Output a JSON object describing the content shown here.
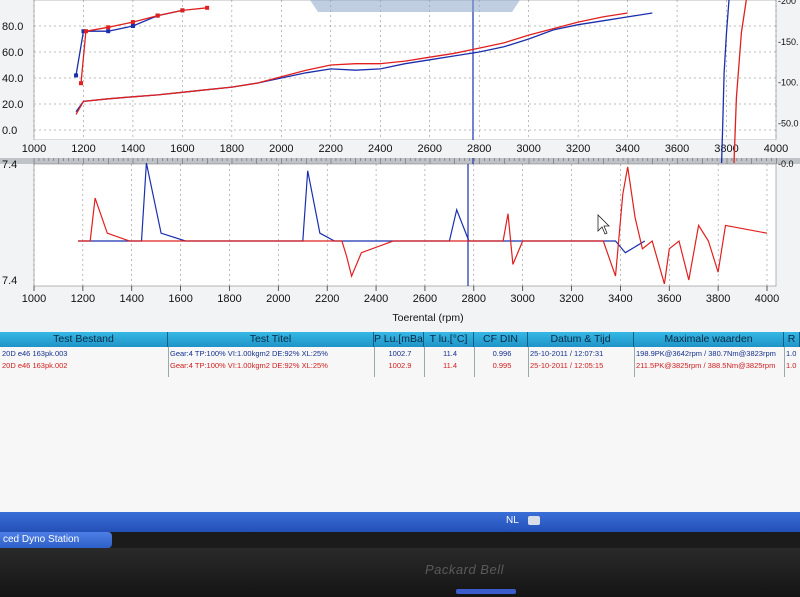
{
  "top_chart": {
    "y_left_ticks": [
      "80.0",
      "60.0",
      "40.0",
      "20.0",
      "0.0"
    ],
    "y_right_ticks": [
      "-200",
      "-150.",
      "-100.",
      "-50.0",
      "-0.0"
    ],
    "x_ticks": [
      "1000",
      "1200",
      "1400",
      "1600",
      "1800",
      "2000",
      "2200",
      "2400",
      "2600",
      "2800",
      "3000",
      "3200",
      "3400",
      "3600",
      "3800",
      "4000"
    ]
  },
  "bottom_chart": {
    "y_ticks": [
      "7.4",
      "7.4"
    ],
    "x_ticks": [
      "1000",
      "1200",
      "1400",
      "1600",
      "1800",
      "2000",
      "2200",
      "2400",
      "2600",
      "2800",
      "3000",
      "3200",
      "3400",
      "3600",
      "3800",
      "4000"
    ],
    "x_label": "Toerental (rpm)"
  },
  "chart_data": [
    {
      "type": "line",
      "x_range": [
        1000,
        4000
      ],
      "ylim": [
        0,
        80
      ],
      "y2lim": [
        0,
        200
      ],
      "x_tick_labels": [
        "1000",
        "1200",
        "1400",
        "1600",
        "1800",
        "2000",
        "2200",
        "2400",
        "2600",
        "2800",
        "3000",
        "3200",
        "3400",
        "3600",
        "3800",
        "4000"
      ],
      "y_tick_labels": [
        "80.0",
        "60.0",
        "40.0",
        "20.0",
        "0.0"
      ],
      "y2_tick_labels": [
        "-200",
        "-150.",
        "-100.",
        "-50.0",
        "-0.0"
      ],
      "colors": {
        "blue": "#1a2fae",
        "red": "#e0201e"
      },
      "series": [
        {
          "color": "blue",
          "x": [
            1170,
            1200,
            1300,
            1400,
            1500,
            1600,
            1700,
            1800,
            1900,
            2000,
            2100,
            2200,
            2300,
            2400,
            2500,
            2600,
            2700,
            2800,
            2900,
            3000,
            3100,
            3200,
            3300,
            3400,
            3500
          ],
          "y": [
            14,
            22,
            24,
            25.5,
            27,
            29,
            31,
            33,
            36,
            40,
            44,
            47,
            46,
            47,
            51,
            54,
            57,
            60,
            64,
            70,
            77,
            81,
            84,
            87,
            90
          ]
        },
        {
          "color": "red",
          "x": [
            1170,
            1200,
            1300,
            1400,
            1500,
            1600,
            1700,
            1800,
            1900,
            2000,
            2100,
            2200,
            2300,
            2400,
            2500,
            2600,
            2700,
            2800,
            2900,
            3000,
            3100,
            3200,
            3300,
            3400
          ],
          "y": [
            12,
            22,
            24,
            25.5,
            27,
            29,
            31,
            33,
            36,
            41,
            46,
            50,
            51,
            51,
            53,
            56,
            59,
            63,
            67,
            73,
            78,
            83,
            87,
            90
          ]
        },
        {
          "color": "blue",
          "x": [
            1170,
            1200,
            1300,
            1400,
            1500,
            1600
          ],
          "y": [
            42,
            76,
            76,
            80,
            88,
            92
          ]
        },
        {
          "color": "red",
          "x": [
            1190,
            1210,
            1300,
            1400,
            1500,
            1600,
            1700
          ],
          "y": [
            36,
            76,
            79,
            83,
            88,
            92,
            94
          ]
        },
        {
          "color": "blue",
          "x": [
            3780,
            3785,
            3790,
            3800,
            3810
          ],
          "y": [
            0,
            50,
            110,
            160,
            200
          ]
        },
        {
          "color": "red",
          "x": [
            3830,
            3835,
            3840,
            3850,
            3860,
            3880
          ],
          "y": [
            0,
            40,
            80,
            120,
            160,
            200
          ]
        }
      ]
    },
    {
      "type": "line",
      "x_range": [
        1000,
        4000
      ],
      "xlabel": "Toerental (rpm)",
      "x_tick_labels": [
        "1000",
        "1200",
        "1400",
        "1600",
        "1800",
        "2000",
        "2200",
        "2400",
        "2600",
        "2800",
        "3000",
        "3200",
        "3400",
        "3600",
        "3800",
        "4000"
      ],
      "y_tick_labels": [
        "7.4",
        "7.4"
      ],
      "colors": {
        "blue": "#1a2fae",
        "red": "#e0201e"
      },
      "series": [
        {
          "color": "blue",
          "x": [
            1180,
            1400,
            1440,
            1460,
            1520,
            1620,
            2060,
            2100,
            2120,
            2170,
            2230,
            2670,
            2700,
            2730,
            2780,
            3380,
            3420,
            3500
          ],
          "y": [
            0,
            0,
            0,
            1.0,
            0.1,
            0,
            0,
            0,
            0.9,
            0.1,
            0,
            0,
            0,
            0.4,
            0,
            0,
            -0.15,
            0
          ]
        },
        {
          "color": "red",
          "x": [
            1180,
            1230,
            1250,
            1300,
            1390,
            2260,
            2280,
            2300,
            2340,
            2470,
            2920,
            2940,
            2960,
            3000,
            3330,
            3380,
            3410,
            3430,
            3460,
            3490,
            3530,
            3580,
            3600,
            3640,
            3680,
            3720,
            3760,
            3800,
            3830,
            4000
          ],
          "y": [
            0,
            0,
            0.55,
            0.1,
            0,
            0,
            -0.2,
            -0.45,
            -0.15,
            0,
            0,
            0.35,
            -0.3,
            0,
            0,
            -0.45,
            0.6,
            0.95,
            0.3,
            -0.1,
            0,
            -0.55,
            -0.1,
            0,
            -0.5,
            0.2,
            0,
            -0.4,
            0.2,
            0.1
          ]
        }
      ]
    }
  ],
  "table": {
    "headers": [
      "Test Bestand",
      "Test Titel",
      "P Lu.[mBar]",
      "T lu.[°C]",
      "CF DIN",
      "Datum & Tijd",
      "Maximale waarden",
      "R"
    ],
    "rows": [
      {
        "file": "20D e46 163pk.003",
        "title": "Gear:4 TP:100% VI:1.00kgm2 DE:92% XL:25%",
        "p": "1002.7",
        "t": "11.4",
        "cf": "0.996",
        "date": "25-10-2011 / 12:07:31",
        "max": "198.9PK@3642rpm / 380.7Nm@3823rpm",
        "r": "1.0",
        "color": "#12308e"
      },
      {
        "file": "20D e46 163pk.002",
        "title": "Gear:4 TP:100% VI:1.00kgm2 DE:92% XL:25%",
        "p": "1002.9",
        "t": "11.4",
        "cf": "0.995",
        "date": "25-10-2011 / 12:05:15",
        "max": "211.5PK@3825rpm / 388.5Nm@3825rpm",
        "r": "1.0",
        "color": "#cf1d1d"
      }
    ]
  },
  "taskbar": {
    "language": "NL",
    "task_label": "ced Dyno Station"
  },
  "bezel": {
    "brand": "Packard Bell"
  }
}
